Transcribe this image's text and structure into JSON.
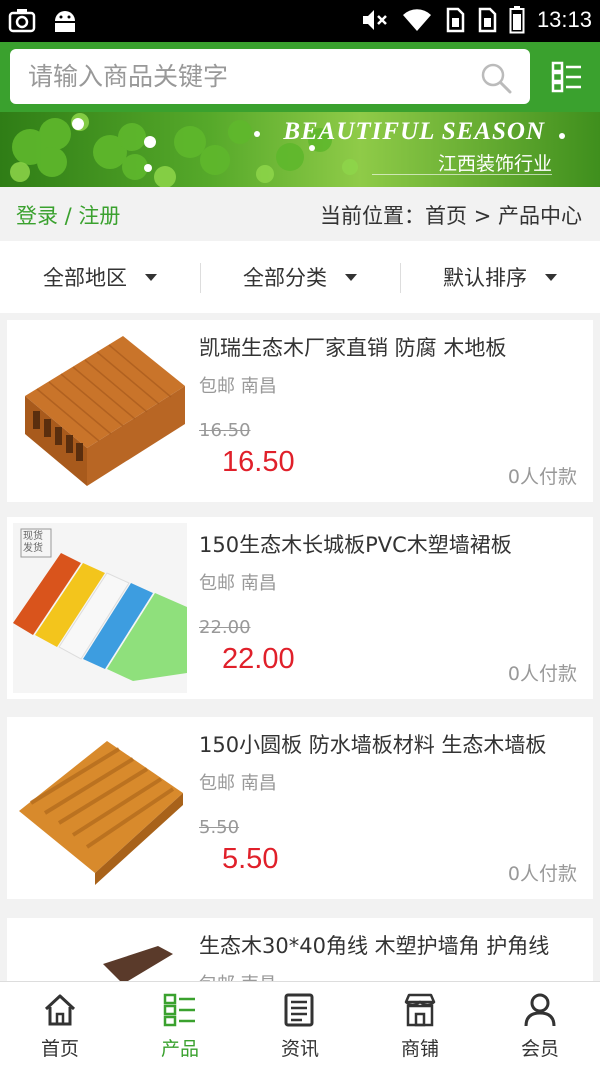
{
  "status_bar": {
    "time": "13:13"
  },
  "search": {
    "placeholder": "请输入商品关键字"
  },
  "banner": {
    "title": "BEAUTIFUL SEASON",
    "subtitle": "江西装饰行业"
  },
  "breadcrumb": {
    "login_label": "登录 / 注册",
    "location": "当前位置：首页 > 产品中心"
  },
  "filters": [
    {
      "label": "全部地区"
    },
    {
      "label": "全部分类"
    },
    {
      "label": "默认排序"
    }
  ],
  "products": [
    {
      "title": "凯瑞生态木厂家直销 防腐 木地板",
      "location": "包邮 南昌",
      "old_price": "16.50",
      "price": "16.50",
      "payers": "0人付款",
      "image": "brown-deck-board"
    },
    {
      "title": "150生态木长城板PVC木塑墙裙板",
      "location": "包邮 南昌",
      "old_price": "22.00",
      "price": "22.00",
      "payers": "0人付款",
      "image": "colored-wall-panels",
      "image_badge": "现货 发货"
    },
    {
      "title": "150小圆板 防水墙板材料 生态木墙板",
      "location": "包邮 南昌",
      "old_price": "5.50",
      "price": "5.50",
      "payers": "0人付款",
      "image": "round-grooved-board"
    },
    {
      "title": "生态木30*40角线 木塑护墙角 护角线",
      "location": "包邮 南昌",
      "old_price": "",
      "price": "",
      "payers": "",
      "image": "corner-trim"
    }
  ],
  "bottom_nav": [
    {
      "label": "首页",
      "icon": "home-icon",
      "active": false
    },
    {
      "label": "产品",
      "icon": "grid-list-icon",
      "active": true
    },
    {
      "label": "资讯",
      "icon": "news-icon",
      "active": false
    },
    {
      "label": "商铺",
      "icon": "shop-icon",
      "active": false
    },
    {
      "label": "会员",
      "icon": "user-icon",
      "active": false
    }
  ],
  "colors": {
    "brand_green": "#3aa12e",
    "price_red": "#e0202a",
    "muted": "#999999"
  }
}
